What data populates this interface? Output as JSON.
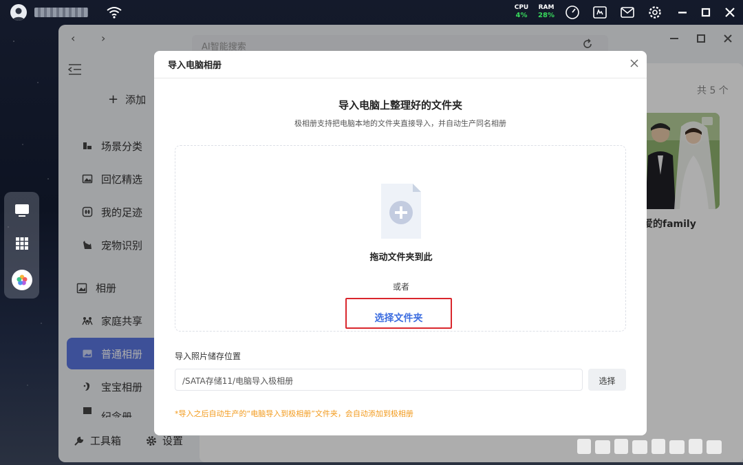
{
  "system": {
    "cpu_label": "CPU",
    "cpu_value": "4%",
    "ram_label": "RAM",
    "ram_value": "28%"
  },
  "app": {
    "search_placeholder": "AI智能搜索",
    "add_label": "添加",
    "total_count": "共 5 个",
    "photo_caption": "爱的family",
    "sidebar": {
      "items": [
        {
          "label": "场景分类",
          "icon": "scene-icon"
        },
        {
          "label": "回忆精选",
          "icon": "image-icon"
        },
        {
          "label": "我的足迹",
          "icon": "footprint-icon"
        },
        {
          "label": "宠物识别",
          "icon": "pet-icon"
        }
      ],
      "section_label": "相册",
      "album_items": [
        {
          "label": "家庭共享",
          "icon": "family-icon"
        },
        {
          "label": "普通相册",
          "icon": "album-icon",
          "active": true
        },
        {
          "label": "宝宝相册",
          "icon": "baby-icon"
        },
        {
          "label": "纪念册",
          "icon": "memorial-icon"
        }
      ],
      "toolbox_label": "工具箱",
      "settings_label": "设置"
    }
  },
  "modal": {
    "header": "导入电脑相册",
    "title": "导入电脑上整理好的文件夹",
    "subtitle": "极相册支持把电脑本地的文件夹直接导入，并自动生产同名相册",
    "drop_text": "拖动文件夹到此",
    "or_text": "或者",
    "choose_folder": "选择文件夹",
    "store_label": "导入照片储存位置",
    "path_value": "/SATA存储11/电脑导入极相册",
    "select_button": "选择",
    "note": "*导入之后自动生产的“电脑导入到极相册”文件夹，会自动添加到极相册"
  },
  "colors": {
    "accent": "#5b77e0",
    "link": "#3c6de0",
    "highlight_border": "#d9262c",
    "note": "#f29a1c",
    "status_green": "#38d95c"
  }
}
